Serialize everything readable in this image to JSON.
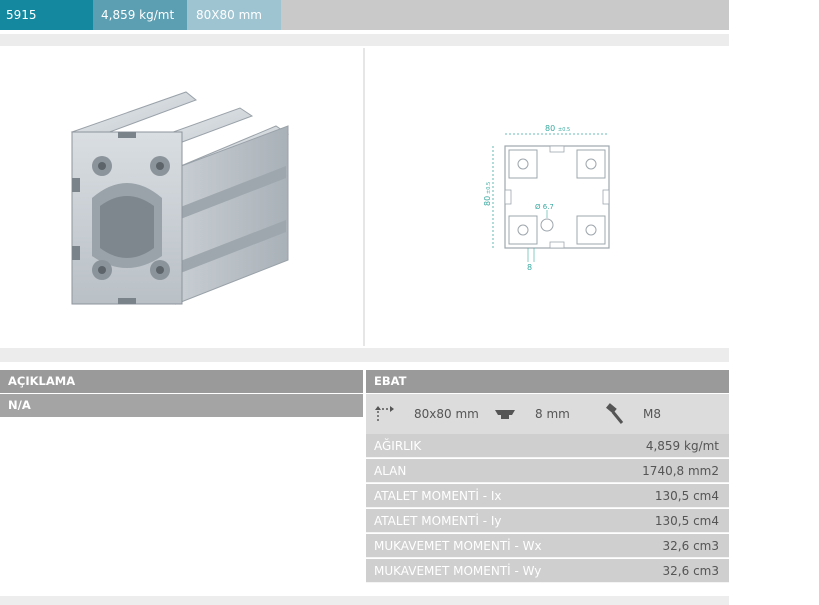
{
  "header": {
    "code": "5915",
    "weight": "4,859 kg/mt",
    "size": "80X80 mm"
  },
  "drawing": {
    "width_label": "80",
    "width_tol": "±0.5",
    "height_label": "80",
    "height_tol": "±0.5",
    "hole_label": "Ø 6.7",
    "slot_label": "8"
  },
  "sections": {
    "description_title": "AÇIKLAMA",
    "description_value": "N/A",
    "dimensions_title": "EBAT"
  },
  "dimensions": {
    "size": "80x80 mm",
    "slot": "8 mm",
    "screw": "M8"
  },
  "properties": [
    {
      "label": "AĞIRLIK",
      "value": "4,859 kg/mt"
    },
    {
      "label": "ALAN",
      "value": "1740,8 mm2"
    },
    {
      "label": "ATALET MOMENTİ - Ix",
      "value": "130,5 cm4"
    },
    {
      "label": "ATALET MOMENTİ - Iy",
      "value": "130,5 cm4"
    },
    {
      "label": "MUKAVEMET MOMENTİ - Wx",
      "value": "32,6 cm3"
    },
    {
      "label": "MUKAVEMET MOMENTİ - Wy",
      "value": "32,6 cm3"
    }
  ],
  "icons": {
    "size": "dimension-arrows-icon",
    "slot": "t-nut-icon",
    "screw": "bolt-icon"
  },
  "colors": {
    "accent_dark": "#14889e",
    "accent_mid": "#5c9eb2",
    "accent_light": "#9ec3d1",
    "drawing_teal": "#3aa9a0"
  }
}
